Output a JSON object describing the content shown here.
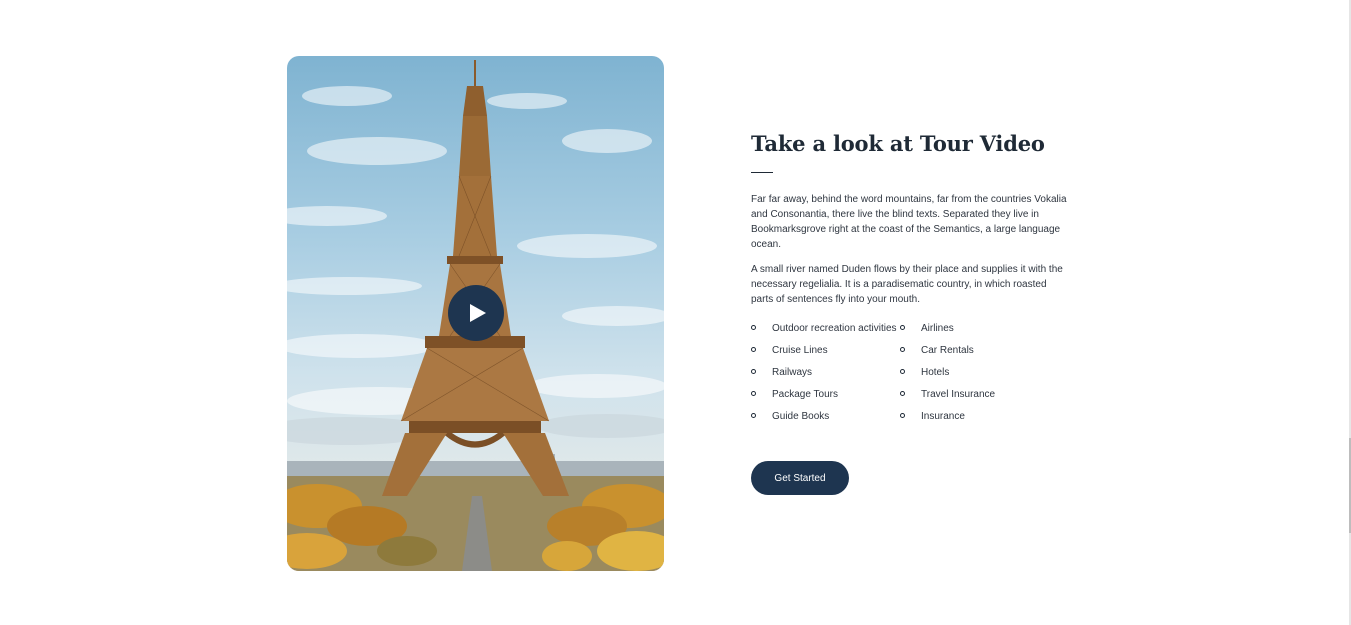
{
  "video": {
    "image_subject": "eiffel-tower-photo",
    "play_icon": "play-icon",
    "accent_color": "#1e3550"
  },
  "section": {
    "title": "Take a look at Tour Video",
    "paragraph_1": "Far far away, behind the word mountains, far from the countries Vokalia and Consonantia, there live the blind texts. Separated they live in Bookmarksgrove right at the coast of the Semantics, a large language ocean.",
    "paragraph_2": "A small river named Duden flows by their place and supplies it with the necessary regelialia. It is a paradisematic country, in which roasted parts of sentences fly into your mouth."
  },
  "list_left": [
    "Outdoor recreation activities",
    "Cruise Lines",
    "Railways",
    "Package Tours",
    "Guide Books"
  ],
  "list_right": [
    "Airlines",
    "Car Rentals",
    "Hotels",
    "Travel Insurance",
    "Insurance"
  ],
  "cta": {
    "label": "Get Started"
  }
}
